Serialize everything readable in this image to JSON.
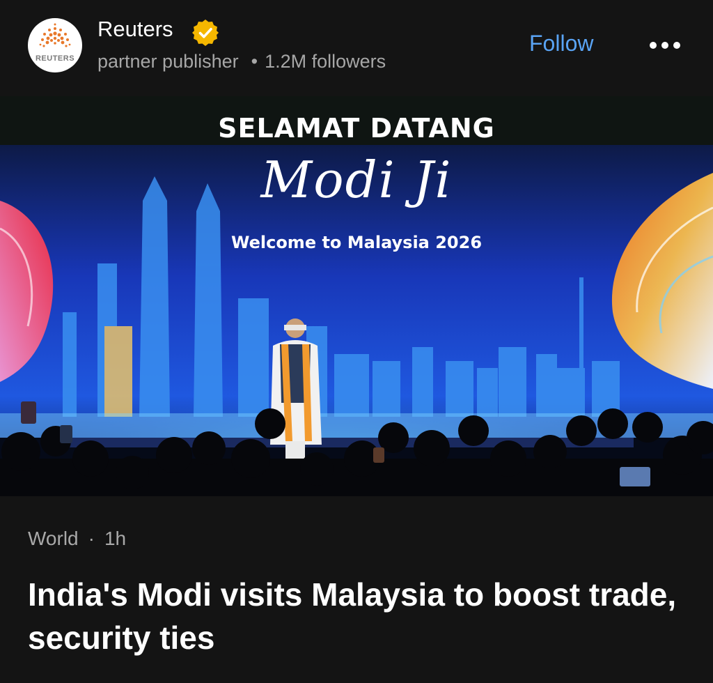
{
  "publisher": {
    "name": "Reuters",
    "logo_text": "REUTERS",
    "verified_icon": "verified-badge-icon",
    "badge_color": "#f5b700",
    "role": "partner publisher",
    "separator": "•",
    "followers": "1.2M followers"
  },
  "actions": {
    "follow_label": "Follow",
    "follow_color": "#5aa4f5",
    "more_icon": "more-options-icon"
  },
  "image": {
    "banner_top": "SELAMAT DATANG",
    "banner_script": "Modi Ji",
    "banner_sub": "Welcome to Malaysia 2026"
  },
  "article": {
    "category": "World",
    "separator": "·",
    "age": "1h",
    "headline": "India's Modi visits Malaysia to boost trade, security ties"
  }
}
